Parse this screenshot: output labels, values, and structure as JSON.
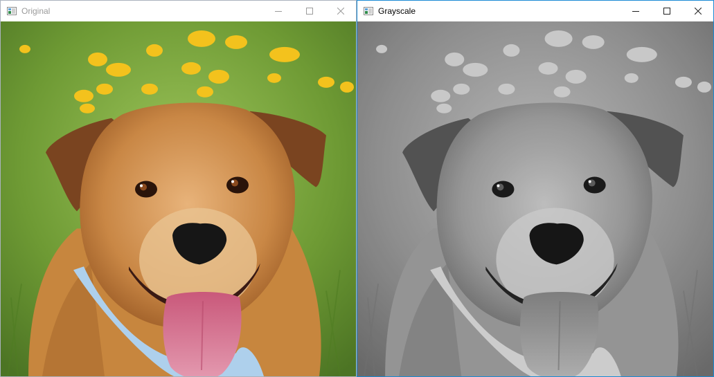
{
  "windows": [
    {
      "title": "Original",
      "active": false,
      "icon": "image-window-icon",
      "controls": [
        "minimize-icon",
        "maximize-icon",
        "close-icon"
      ]
    },
    {
      "title": "Grayscale",
      "active": true,
      "icon": "image-window-icon",
      "controls": [
        "minimize-icon",
        "maximize-icon",
        "close-icon"
      ]
    }
  ],
  "colors": {
    "active_border": "#1a8ad4",
    "inactive_border": "#aab2bd",
    "inactive_title": "#9a9a9a",
    "active_title": "#000000"
  }
}
